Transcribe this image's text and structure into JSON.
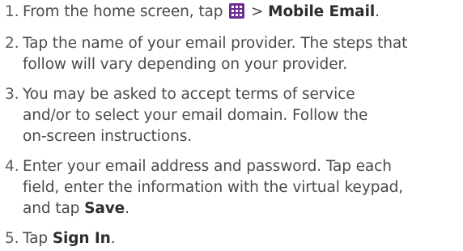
{
  "steps": [
    {
      "number": "1.",
      "lines": [
        {
          "pre": "From the home screen, tap ",
          "icon": "apps-grid-icon",
          "mid": " > ",
          "bold": "Mobile Email",
          "post": "."
        }
      ]
    },
    {
      "number": "2.",
      "lines": [
        {
          "text": "Tap the name of your email provider. The steps that"
        },
        {
          "text": "follow will vary depending on your provider."
        }
      ]
    },
    {
      "number": "3.",
      "lines": [
        {
          "text": "You may be asked to accept terms of service"
        },
        {
          "text": "and/or to select your email domain. Follow the"
        },
        {
          "text": "on-screen instructions."
        }
      ]
    },
    {
      "number": "4.",
      "lines": [
        {
          "text": "Enter your email address and password. Tap each"
        },
        {
          "text": "field, enter the information with the virtual keypad,"
        },
        {
          "pre": "and tap ",
          "bold": "Save",
          "post": "."
        }
      ]
    },
    {
      "number": "5.",
      "lines": [
        {
          "pre": "Tap ",
          "bold": "Sign In",
          "post": "."
        }
      ]
    }
  ],
  "colors": {
    "text": "#4a4a4a",
    "icon_bg": "#6b2d8e"
  }
}
